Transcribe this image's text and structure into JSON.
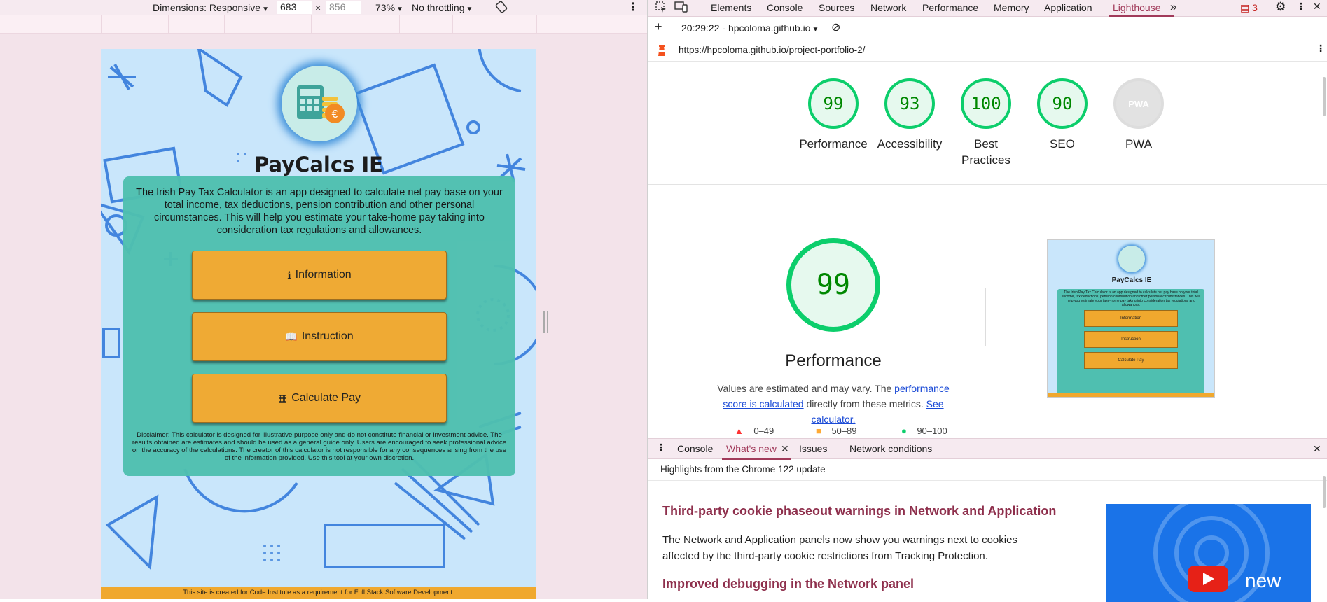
{
  "device_toolbar": {
    "dimensions_label": "Dimensions: Responsive",
    "width": "683",
    "times": "×",
    "height": "856",
    "zoom": "73%",
    "throttling": "No throttling"
  },
  "app_page": {
    "title": "PayCalcs IE",
    "intro": "The Irish Pay Tax Calculator is an app designed to calculate net pay base on your total income, tax deductions, pension contribution and other personal circumstances. This will help you estimate your take-home pay taking into consideration tax regulations and allowances.",
    "buttons": [
      {
        "icon": "info-icon",
        "label": "Information"
      },
      {
        "icon": "book-icon",
        "label": "Instruction"
      },
      {
        "icon": "calculator-icon",
        "label": "Calculate Pay"
      }
    ],
    "disclaimer": "Disclaimer: This calculator is designed for illustrative purpose only and do not constitute financial or investment advice. The results obtained are estimates and should be used as a general guide only. Users are encouraged to seek professional advice on the accuracy of the calculations. The creator of this calculator is not responsible for any consequences arising from the use of the information provided. Use this tool at your own discretion.",
    "footer": "This site is created for Code Institute as a requirement for Full Stack Software Development.",
    "colors": {
      "background": "#c9e6fb",
      "card": "#4fbfb0",
      "button": "#f0a82e"
    }
  },
  "devtools": {
    "tabs": [
      "Elements",
      "Console",
      "Sources",
      "Network",
      "Performance",
      "Memory",
      "Application",
      "Lighthouse"
    ],
    "active_tab": "Lighthouse",
    "more_tabs": "»",
    "issues_count": "3",
    "report_time": "20:29:22 - hpcoloma.github.io",
    "url": "https://hpcoloma.github.io/project-portfolio-2/"
  },
  "lighthouse": {
    "scores": [
      {
        "value": "99",
        "label": "Performance"
      },
      {
        "value": "93",
        "label": "Accessibility"
      },
      {
        "value": "100",
        "label": "Best Practices"
      },
      {
        "value": "90",
        "label": "SEO"
      },
      {
        "value": "PWA",
        "label": "PWA"
      }
    ],
    "main_score": "99",
    "main_title": "Performance",
    "note_prefix": "Values are estimated and may vary. The ",
    "note_link1": "performance score is calculated",
    "note_mid": " directly from these metrics. ",
    "note_link2": "See calculator.",
    "legend": [
      {
        "range": "0–49",
        "color": "#ff3333"
      },
      {
        "range": "50–89",
        "color": "#ffaa33"
      },
      {
        "range": "90–100",
        "color": "#0cce6b"
      }
    ]
  },
  "drawer": {
    "tabs": [
      "Console",
      "What's new",
      "Issues",
      "Network conditions"
    ],
    "active_tab": "What's new",
    "highlights": "Highlights from the Chrome 122 update",
    "heading1": "Third-party cookie phaseout warnings in Network and Application",
    "paragraph1": "The Network and Application panels now show you warnings next to cookies affected by the third-party cookie restrictions from Tracking Protection.",
    "heading2": "Improved debugging in the Network panel",
    "video_badge": "new"
  }
}
